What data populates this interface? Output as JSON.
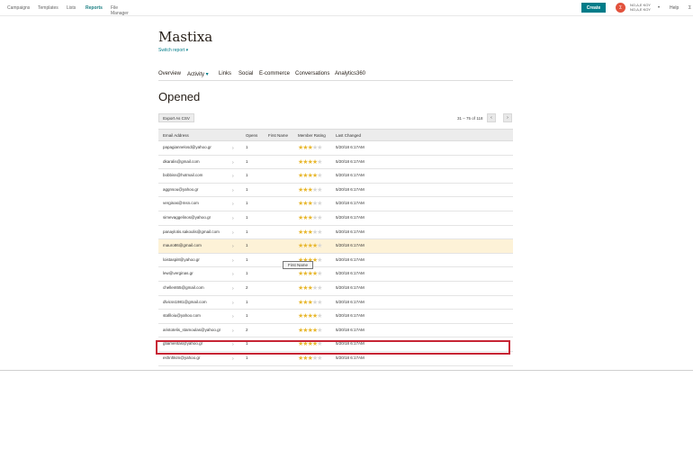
{
  "topnav": {
    "items": [
      "Campaigns",
      "Templates",
      "Lists",
      "Reports",
      "File Manager"
    ],
    "create_label": "Create",
    "avatar_initial": "Σ",
    "account_line1": "ΝΟ,Δ,Ε ΚΟΥ",
    "account_line2": "ΝΟ,Δ,Ε ΚΟΥ",
    "help_label": "Help",
    "extra_label": "Σ"
  },
  "report": {
    "title": "Mastixa",
    "switch_label": "Switch report"
  },
  "tabs": [
    "Overview",
    "Activity",
    "Links",
    "Social",
    "E-commerce",
    "Conversations",
    "Analytics360"
  ],
  "section_title": "Opened",
  "export_label": "Export As CSV",
  "pager": {
    "range": "31 – 75",
    "of_label": "of",
    "total": "118",
    "prev": "‹",
    "next": "›"
  },
  "table": {
    "headers": [
      "Email Address",
      "Opens",
      "First Name",
      "Member Rating",
      "Last Changed"
    ],
    "rows": [
      {
        "email": "papagiannelosd@yahoo.gr",
        "opens": "1",
        "rating": 3,
        "date": "5/20/18 6:17AM"
      },
      {
        "email": "dkaralis@gmail.com",
        "opens": "1",
        "rating": 4,
        "date": "5/20/18 6:17AM"
      },
      {
        "email": "bobbiss@hotmail.com",
        "opens": "1",
        "rating": 4,
        "date": "5/20/18 6:17AM"
      },
      {
        "email": "aggnsou@yahoo.gr",
        "opens": "1",
        "rating": 3,
        "date": "5/20/18 6:17AM"
      },
      {
        "email": "verginas@msn.com",
        "opens": "1",
        "rating": 3,
        "date": "5/20/18 6:17AM"
      },
      {
        "email": "simevaggelinos@yahoo.gr",
        "opens": "1",
        "rating": 3,
        "date": "5/20/18 6:17AM"
      },
      {
        "email": "panaylotis.sakoulis@gmail.com",
        "opens": "1",
        "rating": 3,
        "date": "5/20/18 6:17AM"
      },
      {
        "email": "mauro86@gmail.com",
        "opens": "1",
        "rating": 4,
        "date": "5/20/18 6:17AM"
      },
      {
        "email": "loistaspi8@yahoo.gr",
        "opens": "1",
        "rating": 4,
        "date": "5/20/18 6:17AM"
      },
      {
        "email": "lew@verginas.gr",
        "opens": "1",
        "rating": 4,
        "date": "5/20/18 6:17AM"
      },
      {
        "email": "chellent65@gmail.com",
        "opens": "2",
        "rating": 3,
        "date": "5/20/18 6:17AM"
      },
      {
        "email": "dlvicss1981@gmail.com",
        "opens": "1",
        "rating": 3,
        "date": "5/20/18 6:17AM"
      },
      {
        "email": "stafiloiu@yahoo.com",
        "opens": "1",
        "rating": 4,
        "date": "5/20/18 6:17AM"
      },
      {
        "email": "aristotelis_stamoulas@yahoo.gr",
        "opens": "2",
        "rating": 4,
        "date": "5/20/18 6:17AM"
      },
      {
        "email": "gtiamentas@yahoo.gr",
        "opens": "1",
        "rating": 4,
        "date": "5/20/18 6:17AM"
      },
      {
        "email": "eshnhkim@yahoo.gr",
        "opens": "1",
        "rating": 3,
        "date": "5/20/18 6:17AM"
      }
    ]
  },
  "tooltip": "First Name",
  "colors": {
    "accent": "#007c89",
    "highlight_row": "#fdf2d7",
    "red_box": "#c72534",
    "star": "#e8b830"
  }
}
